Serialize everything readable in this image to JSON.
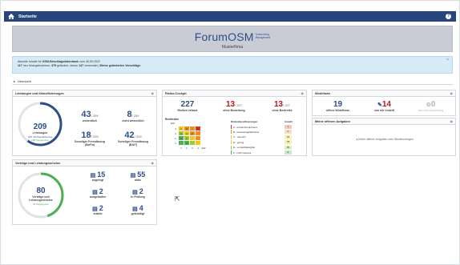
{
  "topbar": {
    "title": "Startseite",
    "help": "?"
  },
  "banner": {
    "logo_main": "ForumOSM",
    "logo_sub_1": "Outsourcing",
    "logo_sub_2": "Management",
    "firm": "Musterfirma"
  },
  "notice": {
    "line1_prefix": "Aktuelle Inhalte für ",
    "line1_bold": "OSM-Beschlagsdatenbank",
    "line1_suffix": " vom 28.09.2022",
    "line2_a": "117",
    "line2_b": " neu hinzugekommen, ",
    "line2_c": "379",
    "line2_d": " geändert, davon ",
    "line2_e": "147",
    "line2_f": " verwendet | ",
    "line2_link": "Meine geänderten Vorschläge",
    "close": "×"
  },
  "overview": {
    "label": "Übersicht"
  },
  "leistungen": {
    "title": "Leistungen und Klassifizierungen",
    "donut_value": "209",
    "donut_label": "Leistungen",
    "donut_sub1": "106 mit Klassifizierung",
    "donut_sub2": "158 freigegeben",
    "donut_fraction": 0.6,
    "s1_num": "43",
    "s1_of": "/ 209",
    "s1_lbl": "wesentlich",
    "s2_num": "8",
    "s2_of": "/ 209",
    "s2_lbl": "nicht wesentlich",
    "s3_num": "18",
    "s3_of": "/ 209",
    "s3_lbl1": "Sonstiger Fremdbezug",
    "s3_lbl2": "(BaFin)",
    "s4_num": "42",
    "s4_of": "/ 209",
    "s4_lbl1": "Sonstiger Fremdbezug",
    "s4_lbl2": "(BAIT)"
  },
  "risiko": {
    "title": "Risiko-Cockpit",
    "r1_num": "227",
    "r1_lbl": "Risiken erfasst",
    "r2_num": "13",
    "r2_of": "/ 227",
    "r2_lbl": "ohne Bewertung",
    "r3_num": "13",
    "r3_of": "/ 227",
    "r3_lbl": "ohne Bestreiks",
    "matrix_title": "Restrisiken",
    "matrix_axis_y": "EW",
    "matrix_axis_x": "EW",
    "matrix_rows": [
      {
        "y": "4",
        "cells": [
          "2",
          "11",
          "",
          "1"
        ],
        "colors": [
          "#f5c518",
          "#f08c1a",
          "#f08c1a",
          "#e0301e"
        ]
      },
      {
        "y": "3",
        "cells": [
          "11",
          "13",
          "17",
          ""
        ],
        "colors": [
          "#9acd32",
          "#f5c518",
          "#f08c1a",
          "#f08c1a"
        ]
      },
      {
        "y": "2",
        "cells": [
          "5",
          "9",
          "",
          ""
        ],
        "colors": [
          "#4caf50",
          "#9acd32",
          "#f5c518",
          "#f08c1a"
        ]
      },
      {
        "y": "1",
        "cells": [
          "",
          "4",
          "",
          ""
        ],
        "colors": [
          "#4caf50",
          "#4caf50",
          "#9acd32",
          "#f5c518"
        ]
      }
    ],
    "matrix_x": [
      "1",
      "2",
      "3",
      "4"
    ],
    "cat_header": "Risikoklassifizierungen",
    "cat_count_header": "Anzahl",
    "categories": [
      {
        "name": "A - existenzbedrohend",
        "count": "1",
        "color": "#e0301e",
        "bg": "#f7c6c1"
      },
      {
        "name": "B - bestandsgefährdend",
        "count": "0",
        "color": "#f08c1a",
        "bg": "#f9dcbd"
      },
      {
        "name": "C - relevant",
        "count": "18",
        "color": "#f5c518",
        "bg": "#fbeeb0"
      },
      {
        "name": "D - gering",
        "count": "78",
        "color": "#d8d820",
        "bg": "#f2f2b0"
      },
      {
        "name": "E - vernachlässigbar",
        "count": "96",
        "color": "#9acd32",
        "bg": "#dff0c0"
      },
      {
        "name": "F - nicht relevant",
        "count": "9",
        "color": "#4caf50",
        "bg": "#c8e6c9"
      }
    ]
  },
  "workflows": {
    "title": "Workflows",
    "w1_num": "19",
    "w1_lbl": "offene Workflows",
    "w2_num": "14",
    "w2_lbl": "von mir erstellt",
    "w3_num": "0",
    "w3_lbl": "neu seit Auswertung"
  },
  "aufgaben": {
    "title": "Meine offenen Aufgaben",
    "empty": "Keine offenen Aufgaben oder Wiedervorlagen"
  },
  "vertraege": {
    "title": "Verträge und Leistungsscheine",
    "donut_value": "80",
    "donut_label1": "Verträge und",
    "donut_label2": "Leistungsscheine",
    "donut_sub": "33 freigegeben",
    "donut_fraction": 0.45,
    "items": [
      {
        "num": "15",
        "lbl": "angelegt"
      },
      {
        "num": "55",
        "lbl": "aktiv"
      },
      {
        "num": "2",
        "lbl": "ausgelaufen"
      },
      {
        "num": "2",
        "lbl": "in Prüfung"
      },
      {
        "num": "2",
        "lbl": "inaktiv"
      },
      {
        "num": "4",
        "lbl": "gekündigt"
      }
    ]
  }
}
